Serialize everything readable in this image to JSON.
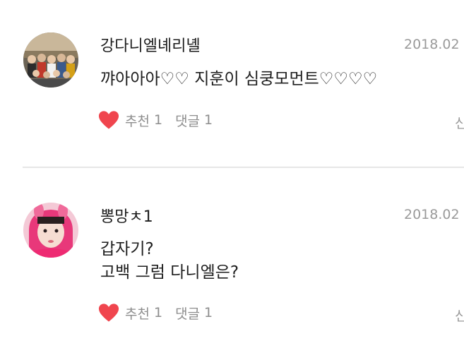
{
  "comments": [
    {
      "author": "강다니엘녜리녤",
      "date": "2018.02",
      "lines": [
        "꺄아아아♡♡ 지훈이 심쿵모먼트♡♡♡♡"
      ],
      "like_label": "추천",
      "like_count": "1",
      "reply_label": "댓글",
      "reply_count": "1",
      "more_label": "신",
      "avatar_icon": "group-photo-avatar"
    },
    {
      "author": "뽕망ㅊ1",
      "date": "2018.02",
      "lines": [
        "갑자기?",
        "고백 그럼 다니엘은?"
      ],
      "like_label": "추천",
      "like_count": "1",
      "reply_label": "댓글",
      "reply_count": "1",
      "more_label": "신",
      "avatar_icon": "child-photo-avatar"
    }
  ],
  "colors": {
    "heart": "#f0454e",
    "meta_text": "#8e8e8e",
    "divider": "#e6e6e6"
  }
}
